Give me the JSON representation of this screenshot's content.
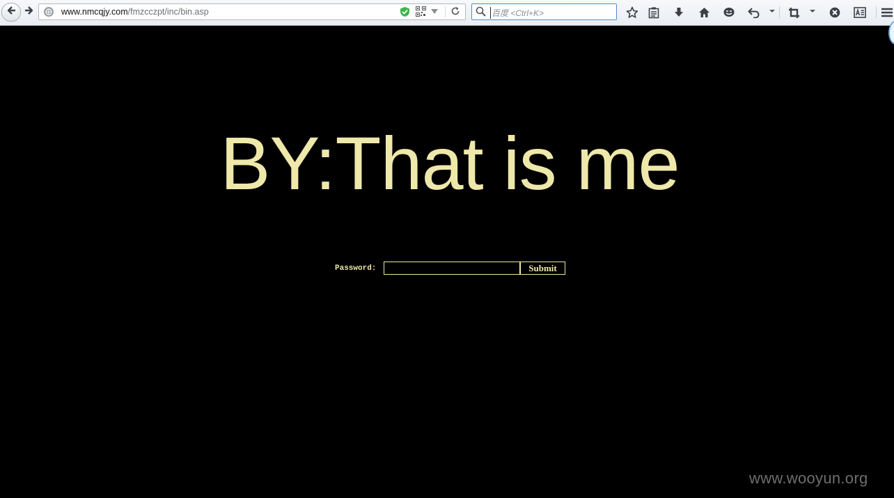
{
  "browser": {
    "url_host": "www.nmcqjy.com",
    "url_path": "/fmzcczpt/inc/bin.asp",
    "search_placeholder": "百度 <Ctrl+K>"
  },
  "page": {
    "title_text": "BY:That is me",
    "password_label": "Password:",
    "password_value": "",
    "submit_label": "Submit"
  },
  "watermark": "www.wooyun.org",
  "colors": {
    "page_background": "#000000",
    "accent_text": "#eee8aa",
    "search_focus_border": "#4f89d0"
  },
  "icons": {
    "toolbar": [
      "back-icon",
      "forward-icon",
      "site-identity-icon",
      "shield-check-icon",
      "qr-code-icon",
      "dropdown-icon",
      "reload-icon",
      "search-icon",
      "bookmark-star-icon",
      "reading-list-icon",
      "download-icon",
      "home-icon",
      "chat-icon",
      "undo-icon",
      "crop-icon",
      "close-circle-icon",
      "reader-icon",
      "menu-icon"
    ]
  }
}
